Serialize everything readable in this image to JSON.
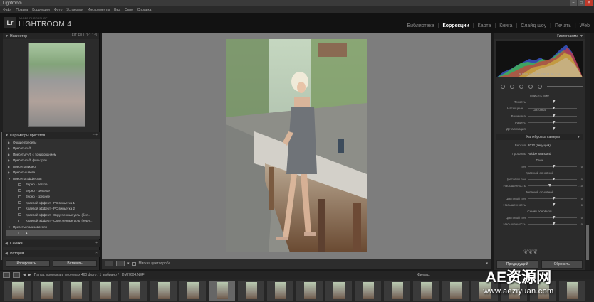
{
  "window": {
    "title": "Lightroom"
  },
  "menu": [
    "Файл",
    "Правка",
    "Коррекции",
    "Фото",
    "Установки",
    "Инструменты",
    "Вид",
    "Окно",
    "Справка"
  ],
  "identity": {
    "brand_small": "ADOBE PHOTOSHOP",
    "product": "LIGHTROOM 4"
  },
  "modules": [
    "Библиотека",
    "Коррекции",
    "Карта",
    "Книга",
    "Слайд шоу",
    "Печать",
    "Web"
  ],
  "active_module": "Коррекции",
  "left": {
    "navigator": {
      "title": "Навигатор",
      "zoom_options": "FIT  FILL  1:1  1:3"
    },
    "presets": {
      "title": "Параметры пресетов",
      "items": [
        {
          "label": "Общие пресеты",
          "level": 0
        },
        {
          "label": "Пресеты Ч/б",
          "level": 0
        },
        {
          "label": "Пресеты Ч/б с тонированием",
          "level": 0
        },
        {
          "label": "Пресеты Ч/б фильтров",
          "level": 0
        },
        {
          "label": "Пресеты видео",
          "level": 0
        },
        {
          "label": "Пресеты цвета",
          "level": 0
        },
        {
          "label": "Пресеты эффектов",
          "level": 0,
          "open": true
        },
        {
          "label": "Зерно - легкое",
          "level": 1
        },
        {
          "label": "Зерно - сильное",
          "level": 1
        },
        {
          "label": "Зерно - среднее",
          "level": 1
        },
        {
          "label": "Краевой эффект - PC виньетка 1",
          "level": 1
        },
        {
          "label": "Краевой эффект - PC виньетка 2",
          "level": 1
        },
        {
          "label": "Краевой эффект - Скругленные углы (бел...",
          "level": 1
        },
        {
          "label": "Краевой эффект - Скругленные углы (черн...",
          "level": 1
        },
        {
          "label": "Пресеты пользователя",
          "level": 0,
          "open": true
        },
        {
          "label": "1",
          "level": 1,
          "selected": true
        }
      ]
    },
    "snapshots": {
      "title": "Снимки"
    },
    "history": {
      "title": "История"
    },
    "buttons": {
      "copy": "Копировать...",
      "paste": "Вставить"
    }
  },
  "center_toolbar": {
    "soft_proof": "Мягкая цветопроба"
  },
  "right": {
    "histogram": {
      "title": "Гистограмма",
      "r_label": "R",
      "r": "55,8",
      "g_label": "G",
      "g": "44,2",
      "b_label": "B",
      "b": "36,3",
      "unit": "%"
    },
    "presence": {
      "title": "Присутствие",
      "rows": [
        "Яркость",
        "Насыщенн..."
      ]
    },
    "sharpen": {
      "title": "Заточка",
      "rows": [
        "Величина",
        "Радиус",
        "Детализация"
      ]
    },
    "calibration": {
      "title": "Калибровка камеры",
      "process_label": "Версия",
      "process_value": "2012 (текущий)",
      "profile_label": "Профиль",
      "profile_value": "Adobe Standard",
      "shadows_title": "Тени",
      "shadows_rows": [
        {
          "label": "Тон",
          "value": "0"
        }
      ],
      "red_title": "Красный основной",
      "red_rows": [
        {
          "label": "Цветовой тон",
          "value": "0"
        },
        {
          "label": "Насыщенность",
          "value": "- 10"
        }
      ],
      "green_title": "Зеленый основной",
      "green_rows": [
        {
          "label": "Цветовой тон",
          "value": "0"
        },
        {
          "label": "Насыщенность",
          "value": "0"
        }
      ],
      "blue_title": "Синий основной",
      "blue_rows": [
        {
          "label": "Цветовой тон",
          "value": "0"
        },
        {
          "label": "Насыщенность",
          "value": "0"
        }
      ]
    },
    "buttons": {
      "previous": "Предыдущий",
      "reset": "Сбросить"
    }
  },
  "filmstrip": {
    "info": "Папка: прогулка в пионерах  460 фото / 1 выбрано / _DMI7604.NEF",
    "filter_label": "Фильтр:",
    "count": 20,
    "selected_index": 7
  },
  "watermark": {
    "line1": "AE资源网",
    "line2": "www.aeziyuan.com"
  }
}
